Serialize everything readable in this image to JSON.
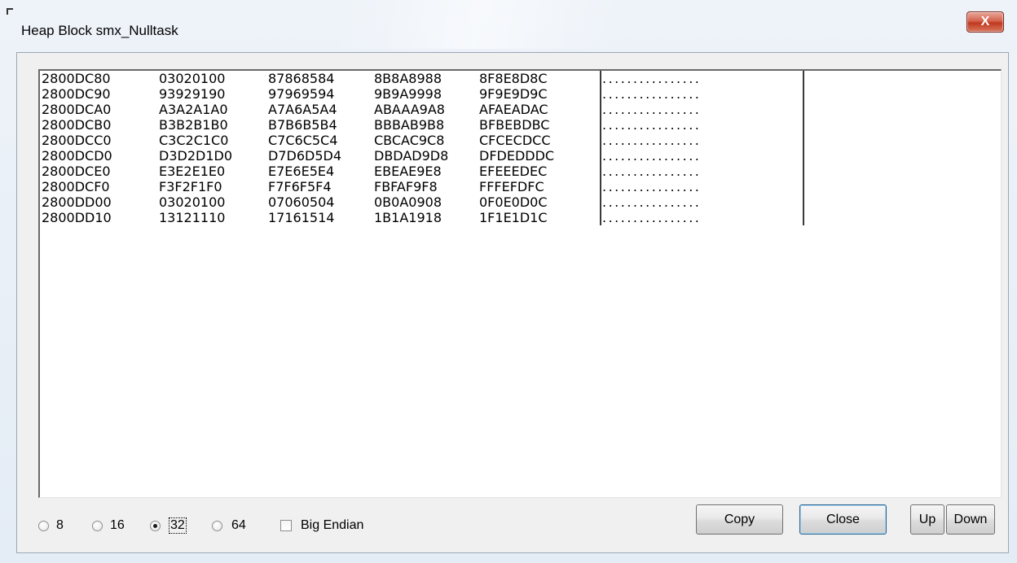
{
  "window": {
    "title": "Heap Block smx_Nulltask",
    "close_glyph": "X"
  },
  "dump": {
    "rows": [
      {
        "addr": "2800DC80",
        "w0": "03020100",
        "w1": "87868584",
        "w2": "8B8A8988",
        "w3": "8F8E8D8C",
        "ascii": "................"
      },
      {
        "addr": "2800DC90",
        "w0": "93929190",
        "w1": "97969594",
        "w2": "9B9A9998",
        "w3": "9F9E9D9C",
        "ascii": "................"
      },
      {
        "addr": "2800DCA0",
        "w0": "A3A2A1A0",
        "w1": "A7A6A5A4",
        "w2": "ABAAA9A8",
        "w3": "AFAEADAC",
        "ascii": "................"
      },
      {
        "addr": "2800DCB0",
        "w0": "B3B2B1B0",
        "w1": "B7B6B5B4",
        "w2": "BBBAB9B8",
        "w3": "BFBEBDBC",
        "ascii": "................"
      },
      {
        "addr": "2800DCC0",
        "w0": "C3C2C1C0",
        "w1": "C7C6C5C4",
        "w2": "CBCAC9C8",
        "w3": "CFCECDCC",
        "ascii": "................"
      },
      {
        "addr": "2800DCD0",
        "w0": "D3D2D1D0",
        "w1": "D7D6D5D4",
        "w2": "DBDAD9D8",
        "w3": "DFDEDDDC",
        "ascii": "................"
      },
      {
        "addr": "2800DCE0",
        "w0": "E3E2E1E0",
        "w1": "E7E6E5E4",
        "w2": "EBEAE9E8",
        "w3": "EFEEEDEC",
        "ascii": "................"
      },
      {
        "addr": "2800DCF0",
        "w0": "F3F2F1F0",
        "w1": "F7F6F5F4",
        "w2": "FBFAF9F8",
        "w3": "FFFEFDFC",
        "ascii": "................"
      },
      {
        "addr": "2800DD00",
        "w0": "03020100",
        "w1": "07060504",
        "w2": "0B0A0908",
        "w3": "0F0E0D0C",
        "ascii": "................"
      },
      {
        "addr": "2800DD10",
        "w0": "13121110",
        "w1": "17161514",
        "w2": "1B1A1918",
        "w3": "1F1E1D1C",
        "ascii": "................"
      }
    ]
  },
  "options": {
    "word_size": [
      {
        "label": "8",
        "checked": false
      },
      {
        "label": "16",
        "checked": false
      },
      {
        "label": "32",
        "checked": true
      },
      {
        "label": "64",
        "checked": false
      }
    ],
    "big_endian": {
      "label": "Big Endian",
      "checked": false
    }
  },
  "buttons": {
    "copy": "Copy",
    "close": "Close",
    "up": "Up",
    "down": "Down"
  }
}
